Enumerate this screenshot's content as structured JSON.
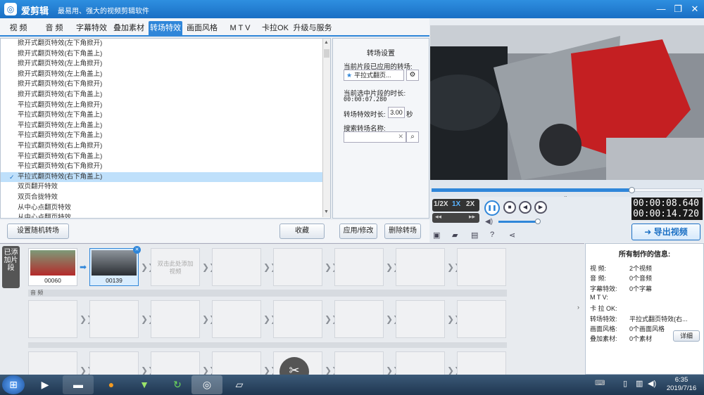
{
  "window": {
    "app_name": "爱剪辑",
    "slogan": "最易用、强大的视频剪辑软件",
    "min": "—",
    "max": "❐",
    "close": "✕"
  },
  "tabs": [
    "视 频",
    "音 频",
    "字幕特效",
    "叠加素材",
    "转场特效",
    "画面风格",
    "M T V",
    "卡拉OK",
    "升级与服务"
  ],
  "transition_list": [
    "掀开式翻页特效(左下角掀开)",
    "掀开式翻页特效(右下角盖上)",
    "掀开式翻页特效(左上角掀开)",
    "掀开式翻页特效(左上角盖上)",
    "掀开式翻页特效(右下角掀开)",
    "掀开式翻页特效(右下角盖上)",
    "平拉式翻页特效(左上角掀开)",
    "平拉式翻页特效(左下角盖上)",
    "平拉式翻页特效(左上角盖上)",
    "平拉式翻页特效(左下角盖上)",
    "平拉式翻页特效(右上角掀开)",
    "平拉式翻页特效(右下角盖上)",
    "平拉式翻页特效(右下角掀开)",
    "平拉式翻页特效(右下角盖上)",
    "双页翻开特效",
    "双页合拢特效",
    "从中心点翻页特效",
    "从中心点翻页特效"
  ],
  "selected_index": 13,
  "settings": {
    "header": "转场设置",
    "applied_label": "当前片段已应用的转场:",
    "applied_value": "平拉式翻页...",
    "duration_label": "当前选中片段的时长:",
    "duration_value": "00:00:07.280",
    "trans_label": "转场特效时长:",
    "trans_value": "3.00",
    "trans_unit": "秒",
    "search_label": "搜索转场名称:",
    "search_value": "",
    "apply_btn": "应用/修改",
    "delete_btn": "删除转场"
  },
  "tools": {
    "random_btn": "设置随机转场",
    "collect_btn": "收藏"
  },
  "player": {
    "speeds": [
      "1/2X",
      "1X",
      "2X"
    ],
    "current_time": "00:00:08.640",
    "total_time": "00:00:14.720",
    "export_btn": "导出视频",
    "progress": 0.74
  },
  "timeline": {
    "side_label": "已添加片段",
    "clips": [
      {
        "label": "00060"
      },
      {
        "label": "00139"
      }
    ],
    "add_hint": "双击此处添加视频",
    "audio_label": "音 频"
  },
  "info": {
    "header": "所有制作的信息:",
    "rows": [
      {
        "k": "视   频:",
        "v": "2个视频"
      },
      {
        "k": "音   频:",
        "v": "0个音频"
      },
      {
        "k": "字幕特效:",
        "v": "0个字幕"
      },
      {
        "k": "M  T  V:",
        "v": ""
      },
      {
        "k": "卡 拉 OK:",
        "v": ""
      },
      {
        "k": "转场特效:",
        "v": "平拉式翻页特效(右..."
      },
      {
        "k": "画面风格:",
        "v": "0个画面风格"
      },
      {
        "k": "叠加素材:",
        "v": "0个素材"
      }
    ],
    "detail_btn": "详细"
  },
  "taskbar": {
    "time": "6:35",
    "date": "2019/7/16"
  }
}
